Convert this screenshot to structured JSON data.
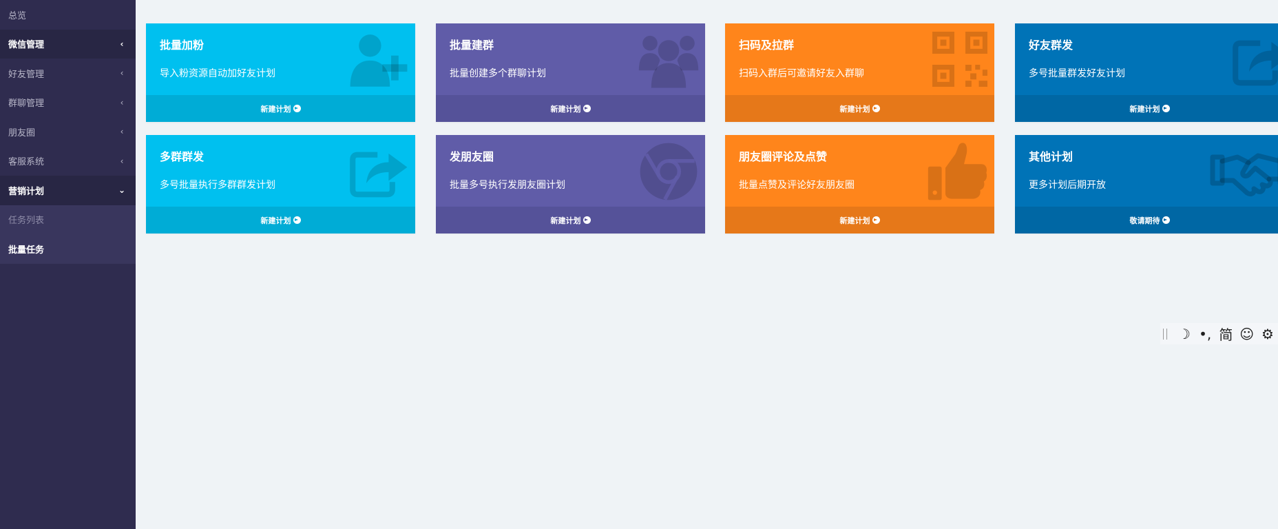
{
  "sidebar": {
    "items": [
      {
        "label": "总览"
      },
      {
        "label": "微信管理",
        "chevron": "‹"
      },
      {
        "label": "好友管理",
        "chevron": "‹"
      },
      {
        "label": "群聊管理",
        "chevron": "‹"
      },
      {
        "label": "朋友圈",
        "chevron": "‹"
      },
      {
        "label": "客服系统",
        "chevron": "‹"
      },
      {
        "label": "营销计划",
        "chevron": "⌄"
      }
    ],
    "sub_items": [
      {
        "label": "任务列表"
      },
      {
        "label": "批量任务"
      }
    ]
  },
  "cards": [
    {
      "title": "批量加粉",
      "desc": "导入粉资源自动加好友计划",
      "action": "新建计划",
      "icon": "user-plus-icon",
      "color": "#00c0ef"
    },
    {
      "title": "批量建群",
      "desc": "批量创建多个群聊计划",
      "action": "新建计划",
      "icon": "users-icon",
      "color": "#605ca8"
    },
    {
      "title": "扫码及拉群",
      "desc": "扫码入群后可邀请好友入群聊",
      "action": "新建计划",
      "icon": "qrcode-icon",
      "color": "#ff851b"
    },
    {
      "title": "好友群发",
      "desc": "多号批量群发好友计划",
      "action": "新建计划",
      "icon": "share-square-icon",
      "color": "#0073b7"
    },
    {
      "title": "多群群发",
      "desc": "多号批量执行多群群发计划",
      "action": "新建计划",
      "icon": "share-square-icon",
      "color": "#00c0ef"
    },
    {
      "title": "发朋友圈",
      "desc": "批量多号执行发朋友圈计划",
      "action": "新建计划",
      "icon": "chrome-icon",
      "color": "#605ca8"
    },
    {
      "title": "朋友圈评论及点赞",
      "desc": "批量点赞及评论好友朋友圈",
      "action": "新建计划",
      "icon": "thumbs-up-icon",
      "color": "#ff851b"
    },
    {
      "title": "其他计划",
      "desc": "更多计划后期开放",
      "action": "敬请期待",
      "icon": "handshake-icon",
      "color": "#0073b7"
    }
  ],
  "ime_toolbar": {
    "moon": "☽",
    "punct": "•,",
    "mode": "简",
    "emoji": "☺",
    "settings": "⚙"
  }
}
